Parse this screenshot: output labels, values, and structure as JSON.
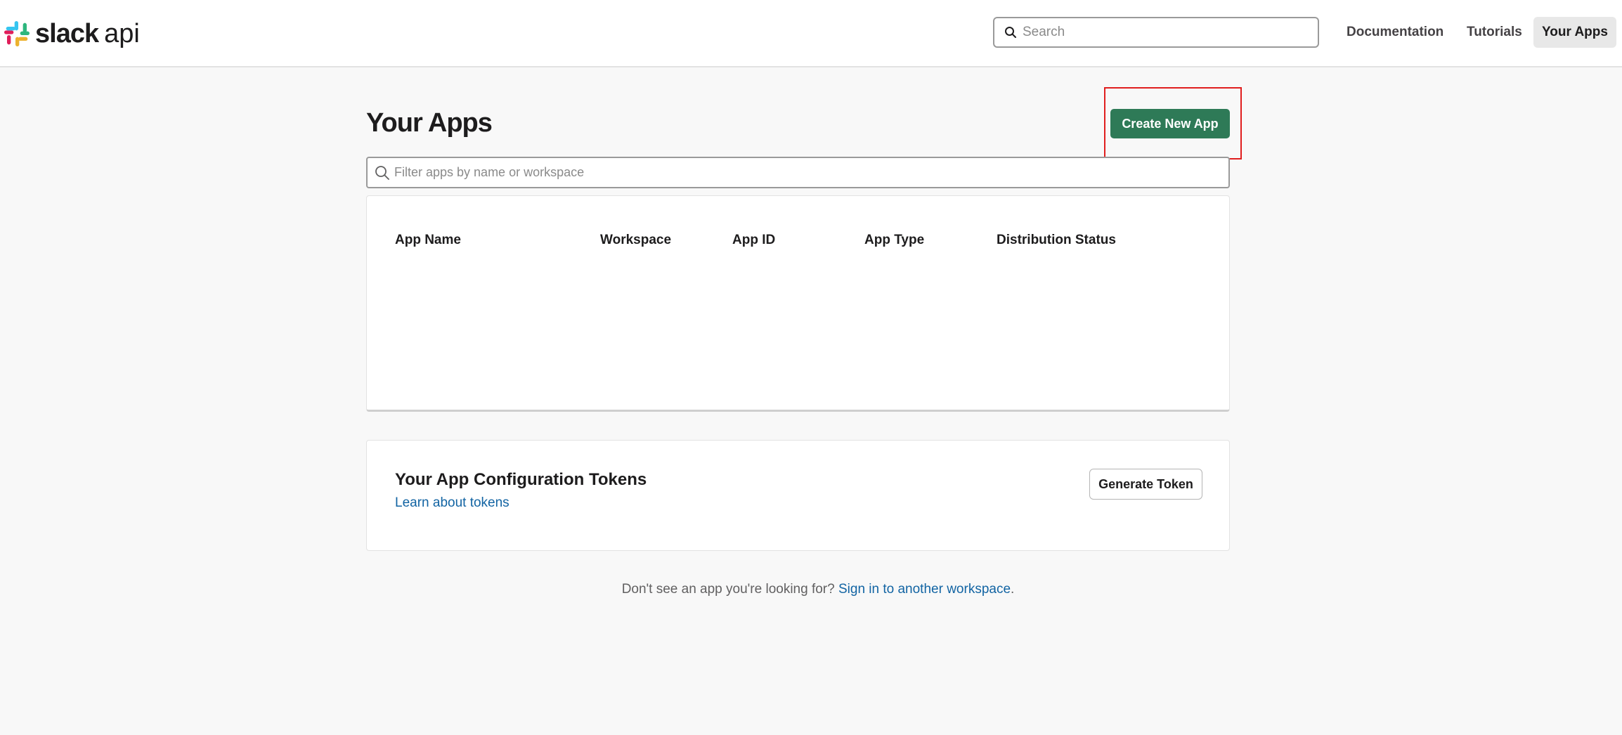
{
  "header": {
    "logo_word": "slack",
    "logo_suffix": "api",
    "search_placeholder": "Search",
    "nav": [
      "Documentation",
      "Tutorials",
      "Your Apps"
    ]
  },
  "main": {
    "title": "Your Apps",
    "create_button": "Create New App",
    "filter_placeholder": "Filter apps by name or workspace",
    "table_columns": [
      "App Name",
      "Workspace",
      "App ID",
      "App Type",
      "Distribution Status"
    ]
  },
  "tokens": {
    "title": "Your App Configuration Tokens",
    "link": "Learn about tokens",
    "button": "Generate Token"
  },
  "footer": {
    "text": "Don't see an app you're looking for?",
    "link": "Sign in to another workspace",
    "trailing": "."
  },
  "colors": {
    "primary_button": "#2e7a57",
    "link": "#1264a3",
    "highlight_box": "#e01e1e"
  }
}
